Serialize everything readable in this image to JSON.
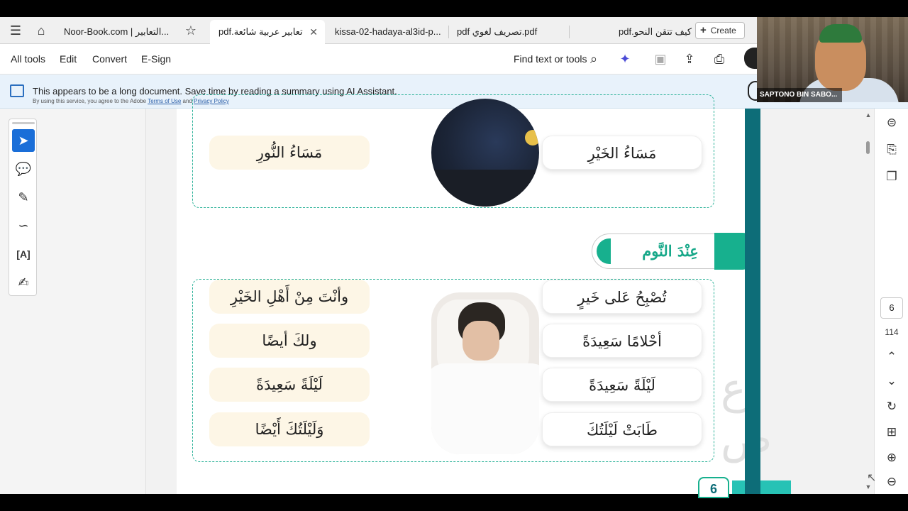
{
  "tabs": [
    {
      "label": "Noor-Book.com | التعابير...",
      "active": false
    },
    {
      "label": "pdf.تعابير عربية شائعة",
      "active": true
    },
    {
      "label": "kissa-02-hadaya-al3id-p...",
      "active": false
    },
    {
      "label": "pdf تصريف لغوي.pdf",
      "active": false
    },
    {
      "label": "pdf.كيف تتقن النحو",
      "active": false
    }
  ],
  "create_label": "Create",
  "toolbar": {
    "menu": [
      "All tools",
      "Edit",
      "Convert",
      "E-Sign"
    ],
    "find_label": "Find text or tools"
  },
  "banner": {
    "text": "This appears to be a long document. Save time by reading a summary using AI Assistant.",
    "small_prefix": "By using this service, you agree to the Adobe",
    "terms_link": "Terms of Use",
    "and_text": "and",
    "privacy_link": "Privacy Policy"
  },
  "page": {
    "evening": {
      "right": "مَسَاءُ الخَيْرِ",
      "left": "مَسَاءُ النُّورِ"
    },
    "heading": "عِنْدَ النَّوم",
    "rows": [
      {
        "right": "تُصْبِحُ عَلى خَيرٍ",
        "left": "وأنْتَ مِنْ أَهْلِ الخَيْرِ"
      },
      {
        "right": "أحْلامًا سَعِيدَةً",
        "left": "ولكَ أيضًا"
      },
      {
        "right": "لَيْلَةً سَعِيدَةً",
        "left": "لَيْلَةً سَعِيدَةً"
      },
      {
        "right": "طَابَتْ لَيْلَتُكَ",
        "left": "وَلَيْلَتُكَ أَيْضًا"
      }
    ],
    "badge_number": "6"
  },
  "navigation": {
    "current_page": "6",
    "total_pages": "114"
  },
  "video": {
    "participant_name": "SAPTONO BIN SABO..."
  },
  "colors": {
    "accent_green": "#17b08e",
    "teal_bar": "#0d6d78",
    "tool_active": "#1a6ed8",
    "banner_bg": "#e8f2fb"
  }
}
